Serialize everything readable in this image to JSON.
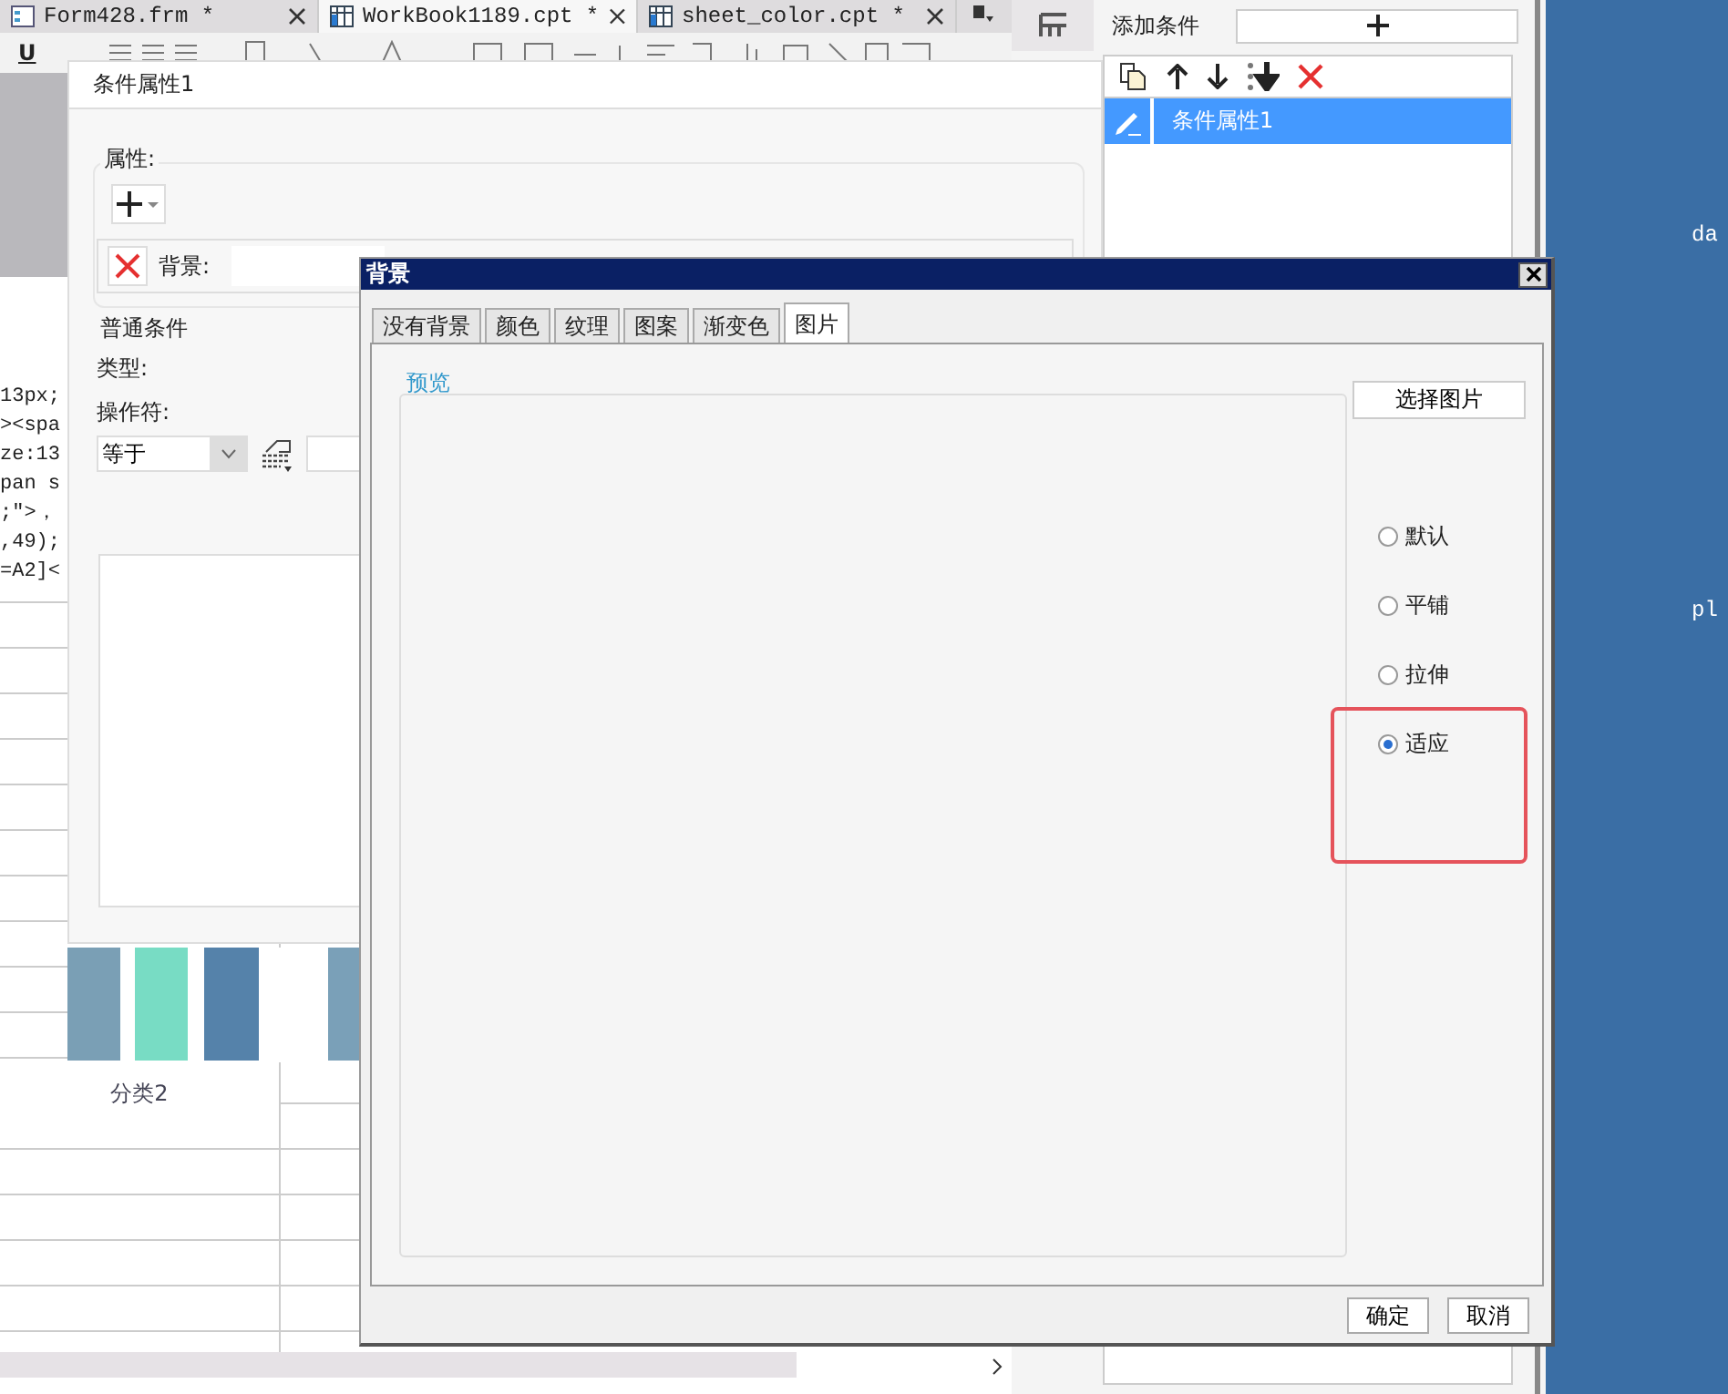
{
  "editor_tabs": [
    {
      "label": "Form428.frm *",
      "selected": false
    },
    {
      "label": "WorkBook1189.cpt *",
      "selected": true
    },
    {
      "label": "sheet_color.cpt *",
      "selected": false
    }
  ],
  "toolbar": {
    "underline": "U"
  },
  "code_lines": [
    "13px;",
    "><spa",
    "ze:13",
    "pan s",
    ";\">，",
    ",49);",
    "=A2]<"
  ],
  "chart_category": "分类2",
  "condition_dialog": {
    "title": "条件属性1",
    "properties_label": "属性:",
    "background_label": "背景:",
    "general_label": "普通条件",
    "type_label": "类型:",
    "operator_label": "操作符:",
    "operator_value": "等于"
  },
  "conditions_panel": {
    "add_label": "添加条件",
    "items": [
      {
        "label": "条件属性1",
        "selected": true
      }
    ]
  },
  "desktop_labels": [
    "da",
    "pl"
  ],
  "background_dialog": {
    "title": "背景",
    "tabs": [
      {
        "label": "没有背景",
        "selected": false
      },
      {
        "label": "颜色",
        "selected": false
      },
      {
        "label": "纹理",
        "selected": false
      },
      {
        "label": "图案",
        "selected": false
      },
      {
        "label": "渐变色",
        "selected": false
      },
      {
        "label": "图片",
        "selected": true
      }
    ],
    "preview_label": "预览",
    "choose_button": "选择图片",
    "fill_modes": [
      {
        "label": "默认",
        "selected": false
      },
      {
        "label": "平铺",
        "selected": false
      },
      {
        "label": "拉伸",
        "selected": false
      },
      {
        "label": "适应",
        "selected": true
      }
    ],
    "buttons": [
      "确定",
      "取消"
    ]
  }
}
